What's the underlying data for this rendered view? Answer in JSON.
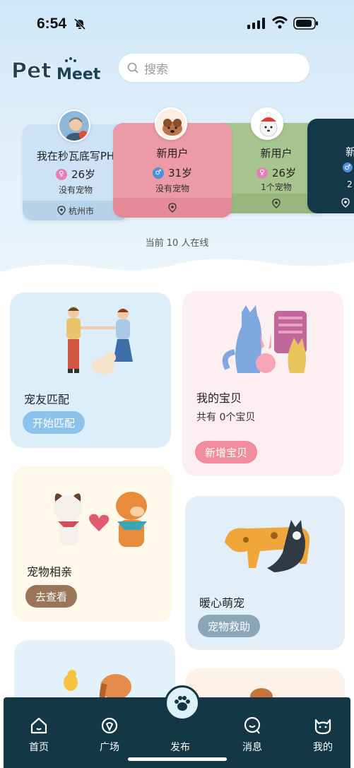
{
  "status_bar": {
    "time": "6:54"
  },
  "header": {
    "logo_text": "PetMeet",
    "search_placeholder": "搜索"
  },
  "users": [
    {
      "name": "我在秒瓦底写PH",
      "age": "26岁",
      "pets": "没有宠物",
      "city": "杭州市",
      "color": "#cde3f5",
      "footer_color": "#b7d3ea",
      "gender": "female"
    },
    {
      "name": "新用户",
      "age": "31岁",
      "pets": "没有宠物",
      "city": "",
      "color": "#ec9aa5",
      "footer_color": "#e48a97",
      "gender": "male"
    },
    {
      "name": "新用户",
      "age": "26岁",
      "pets": "1个宠物",
      "city": "",
      "color": "#a7c58e",
      "footer_color": "#98b87f",
      "gender": "female"
    },
    {
      "name": "新",
      "age": "2",
      "pets": "",
      "city": "",
      "color": "#153848",
      "footer_color": "#153848",
      "gender": "male"
    }
  ],
  "online": "当前 10 人在线",
  "features": {
    "match": {
      "title": "宠友匹配",
      "button": "开始匹配"
    },
    "mypets": {
      "title": "我的宝贝",
      "count": "共有 0个宝贝",
      "button": "新增宝贝"
    },
    "dating": {
      "title": "宠物相亲",
      "button": "去查看"
    },
    "rescue": {
      "title": "暖心萌宠",
      "button": "宠物救助"
    }
  },
  "tabs": [
    "首页",
    "广场",
    "发布",
    "消息",
    "我的"
  ],
  "colors": {
    "accent_dark": "#143745",
    "pink": "#f08c9e",
    "blue_pill": "#8cc3ec",
    "brown_pill": "#9a7558",
    "gray_blue_pill": "#8aa7ba"
  }
}
